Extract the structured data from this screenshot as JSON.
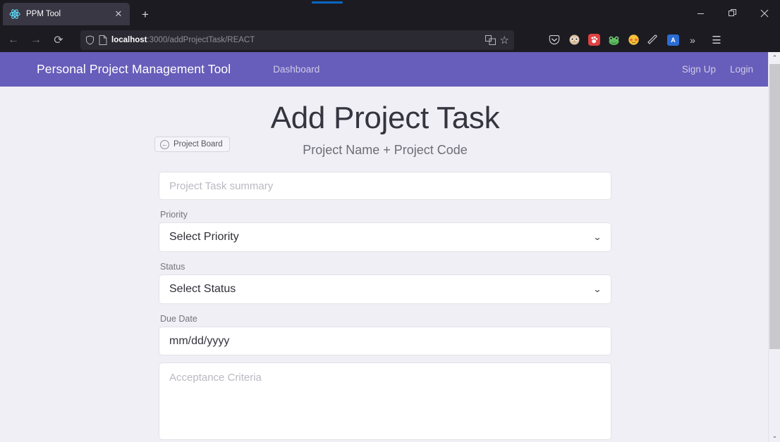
{
  "browser": {
    "tab": {
      "title": "PPM Tool",
      "favicon": "react-logo-icon",
      "close_label": "✕"
    },
    "new_tab_label": "+",
    "window_controls": {
      "minimize": "–",
      "restore": "❐",
      "close": "✕"
    },
    "nav": {
      "back": "←",
      "forward": "→",
      "reload": "⟳"
    },
    "url": {
      "host": "localhost",
      "path": ":3000/addProjectTask/REACT",
      "full": "localhost:3000/addProjectTask/REACT"
    },
    "url_icons": {
      "shield": "shield-icon",
      "page": "page-icon",
      "translate": "translate-icon",
      "bookmark": "☆"
    },
    "extensions": [
      {
        "name": "pocket-icon",
        "glyph": "▽"
      },
      {
        "name": "owl-extension-icon",
        "glyph": "🧑"
      },
      {
        "name": "red-paw-extension-icon",
        "glyph": "🐾"
      },
      {
        "name": "frog-extension-icon",
        "glyph": "🐸"
      },
      {
        "name": "star-struck-extension-icon",
        "glyph": "🤩"
      },
      {
        "name": "pen-extension-icon",
        "glyph": "╱"
      },
      {
        "name": "translate-extension-icon",
        "glyph": "A"
      }
    ],
    "overflow_label": "»",
    "menu_label": "☰"
  },
  "page": {
    "navbar": {
      "brand": "Personal Project Management Tool",
      "dashboard": "Dashboard",
      "sign_up": "Sign Up",
      "login": "Login"
    },
    "back_button": {
      "label": "Project Board",
      "icon": "←"
    },
    "title": "Add Project Task",
    "subtitle": "Project Name + Project Code",
    "form": {
      "summary": {
        "placeholder": "Project Task summary",
        "value": ""
      },
      "priority": {
        "label": "Priority",
        "value": "Select Priority",
        "chevron": "⌄"
      },
      "status": {
        "label": "Status",
        "value": "Select Status",
        "chevron": "⌄"
      },
      "due_date": {
        "label": "Due Date",
        "value": "mm/dd/yyyy"
      },
      "acceptance": {
        "placeholder": "Acceptance Criteria",
        "value": ""
      }
    }
  },
  "scrollbar": {
    "up": "⌃",
    "down": "⌄"
  },
  "colors": {
    "navbar_purple": "#675dba",
    "page_background": "#f0eff5",
    "chrome_dark": "#1c1b22",
    "tab_active": "#383743",
    "loadbar_blue": "#0a67c4"
  }
}
